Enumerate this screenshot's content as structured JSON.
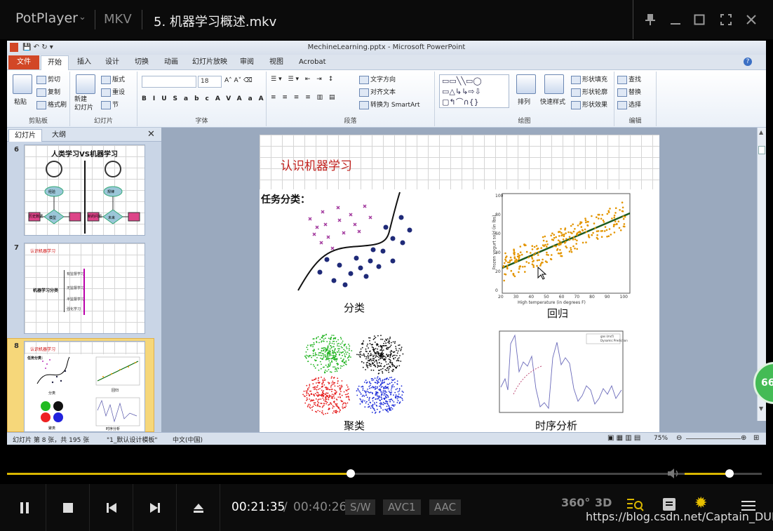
{
  "player": {
    "brand": "PotPlayer",
    "format": "MKV",
    "title": "5. 机器学习概述.mkv",
    "time_current": "00:21:35",
    "time_sep": "/",
    "time_total": "00:40:26",
    "seek_progress": 0.455,
    "volume_level": 0.6,
    "tags": [
      "S/W",
      "AVC1",
      "AAC"
    ],
    "icons_right": [
      "360-icon",
      "3d-icon",
      "playlist-search-icon",
      "list-icon",
      "gear-icon",
      "menu-icon"
    ],
    "badge": "66",
    "watermark": "https://blog.csdn.net/Captain_DUDU",
    "accent": "#d9b600"
  },
  "ppt": {
    "window_title": "MechineLearning.pptx - Microsoft PowerPoint",
    "tabs": [
      "文件",
      "开始",
      "插入",
      "设计",
      "切换",
      "动画",
      "幻灯片放映",
      "审阅",
      "视图",
      "Acrobat"
    ],
    "groups": {
      "clipboard": {
        "label": "剪贴板",
        "paste": "粘贴",
        "cut": "剪切",
        "copy": "复制",
        "format_painter": "格式刷"
      },
      "slides": {
        "label": "幻灯片",
        "new_slide": "新建\n幻灯片",
        "layout": "版式",
        "reset": "重设",
        "section": "节"
      },
      "font": {
        "label": "字体",
        "size": "18",
        "buttons": [
          "B",
          "I",
          "U",
          "S",
          "abc",
          "AV",
          "Aa",
          "A"
        ]
      },
      "paragraph": {
        "label": "段落",
        "text_direction": "文字方向",
        "align_text": "对齐文本",
        "smartart": "转换为 SmartArt"
      },
      "drawing": {
        "label": "绘图",
        "arrange": "排列",
        "quick_styles": "快速样式",
        "fill": "形状填充",
        "outline": "形状轮廓",
        "effects": "形状效果"
      },
      "editing": {
        "label": "编辑",
        "find": "查找",
        "replace": "替换",
        "select": "选择"
      }
    },
    "panel_tabs": [
      "幻灯片",
      "大纲"
    ],
    "thumbs": [
      {
        "num": "6",
        "title": "人类学习VS机器学习",
        "labels": [
          "经验",
          "规律",
          "历史数据",
          "模型",
          "新的问题",
          "未来"
        ]
      },
      {
        "num": "7",
        "title": "认识机器学习",
        "center": "机器学习分类",
        "items": [
          "有监督学习",
          "无监督学习",
          "半监督学习",
          "强化学习"
        ]
      },
      {
        "num": "8",
        "title": "认识机器学习",
        "labels": [
          "任务分类：",
          "分类",
          "回归",
          "聚类",
          "时序分析"
        ]
      }
    ],
    "slide": {
      "title": "认识机器学习",
      "task_label": "任务分类：",
      "quads": [
        "分类",
        "回归",
        "聚类",
        "时序分析"
      ],
      "regression_xlabel": "High temperature (in degrees F)",
      "regression_ylabel": "Frozen yogurt sold (in lbs)",
      "regression_xticks": [
        "20",
        "30",
        "40",
        "50",
        "60",
        "70",
        "80",
        "90",
        "100"
      ],
      "regression_yticks": [
        "0",
        "20",
        "40",
        "60",
        "80",
        "100"
      ],
      "ts_legend": [
        "gas (mcf)",
        "Dynamic Prediction"
      ]
    },
    "status": {
      "slide_info": "幻灯片 第 8 张，共 195 张",
      "theme": "\"1_默认设计模板\"",
      "lang": "中文(中国)",
      "zoom": "75%"
    }
  }
}
